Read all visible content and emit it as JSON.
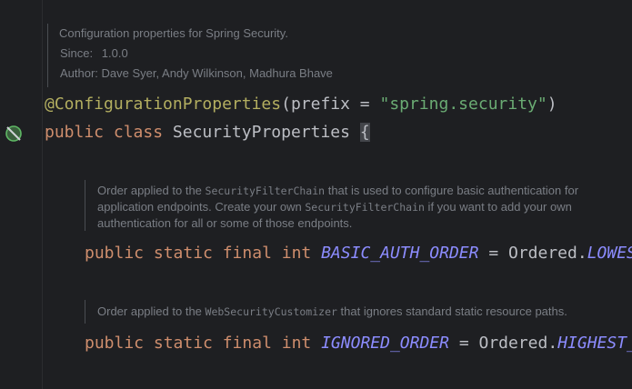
{
  "class_doc": {
    "description": "Configuration properties for Spring Security.",
    "since_label": "Since:",
    "since_value": "1.0.0",
    "author_label": "Author:",
    "author_value": "Dave Syer, Andy Wilkinson, Madhura Bhave"
  },
  "annotation_line": {
    "annotation": "@ConfigurationProperties",
    "open_paren": "(",
    "param": "prefix",
    "equals": " = ",
    "value": "\"spring.security\"",
    "close_paren": ")"
  },
  "class_decl": {
    "kw_public": "public",
    "kw_class": "class",
    "class_name": "SecurityProperties",
    "open_brace": "{"
  },
  "field1_doc": {
    "t1": "Order applied to the ",
    "c1": "SecurityFilterChain",
    "t2": " that is used to configure basic authentication for",
    "t3": "application endpoints. Create your own ",
    "c2": "SecurityFilterChain",
    "t4": " if you want to add your own",
    "t5": "authentication for all or some of those endpoints."
  },
  "field1": {
    "modifiers": "public static final int",
    "name": "BASIC_AUTH_ORDER",
    "equals": " = ",
    "ref": "Ordered.",
    "const": "LOWEST_PRECEDENCE"
  },
  "field2_doc": {
    "t1": "Order applied to the ",
    "c1": "WebSecurityCustomizer",
    "t2": " that ignores standard static resource paths."
  },
  "field2": {
    "modifiers": "public static final int",
    "name": "IGNORED_ORDER",
    "equals": " = ",
    "ref": "Ordered.",
    "const": "HIGHEST_PRECEDENCE"
  },
  "icons": {
    "gutter": "bean-no-icon"
  }
}
